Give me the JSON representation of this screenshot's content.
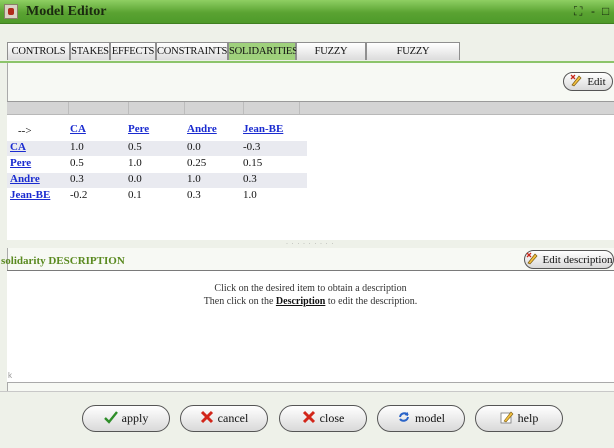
{
  "window": {
    "title": "Model Editor",
    "controls": [
      "⛶",
      "-",
      "□"
    ]
  },
  "tabs": [
    {
      "label": "CONTROLS",
      "active": false
    },
    {
      "label": "STAKES",
      "active": false
    },
    {
      "label": "EFFECTS",
      "active": false
    },
    {
      "label": "CONSTRAINTS",
      "active": false
    },
    {
      "label": "SOLIDARITIES",
      "active": true
    },
    {
      "label": "FUZZY STAKES",
      "active": false
    },
    {
      "label": "FUZZY SOLIDARITIES",
      "active": false
    }
  ],
  "toolbar": {
    "edit_label": "Edit"
  },
  "matrix": {
    "corner": "-->",
    "columns": [
      "CA",
      "Pere",
      "Andre",
      "Jean-BE"
    ],
    "rows": [
      {
        "name": "CA",
        "values": [
          "1.0",
          "0.5",
          "0.0",
          "-0.3"
        ]
      },
      {
        "name": "Pere",
        "values": [
          "0.5",
          "1.0",
          "0.25",
          "0.15"
        ]
      },
      {
        "name": "Andre",
        "values": [
          "0.3",
          "0.0",
          "1.0",
          "0.3"
        ]
      },
      {
        "name": "Jean-BE",
        "values": [
          "-0.2",
          "0.1",
          "0.3",
          "1.0"
        ]
      }
    ]
  },
  "description": {
    "title": "solidarity DESCRIPTION",
    "edit_label": "Edit description",
    "line1": "Click on the desired item to obtain a description",
    "line2_before": "Then click on the ",
    "line2_link": "Description",
    "line2_after": " to edit the description.",
    "corner_mark": "k"
  },
  "buttons": {
    "apply": "apply",
    "cancel": "cancel",
    "close": "close",
    "model": "model",
    "help": "help"
  },
  "colors": {
    "accent": "#5aa332",
    "active_tab": "#9fd17c",
    "link": "#1a2bd0"
  }
}
